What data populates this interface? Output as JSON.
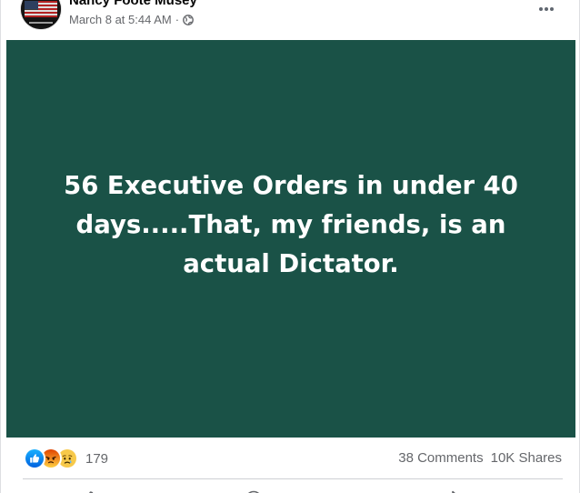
{
  "post": {
    "author": "Nancy Foote Musey",
    "timestamp": "March 8 at 5:44 AM",
    "separator": "·",
    "privacy_icon": "globe-icon",
    "more_icon": "more-horizontal-icon",
    "media_background": "#1a5247",
    "media_text": "56 Executive Orders in under 40 days.....That, my friends, is an actual Dictator."
  },
  "stats": {
    "reaction_icons": [
      "like-icon",
      "angry-icon",
      "sad-icon"
    ],
    "reaction_count": "179",
    "comments": "38 Comments",
    "shares": "10K Shares"
  },
  "actions": [
    "like-action-icon",
    "comment-action-icon",
    "share-action-icon"
  ]
}
